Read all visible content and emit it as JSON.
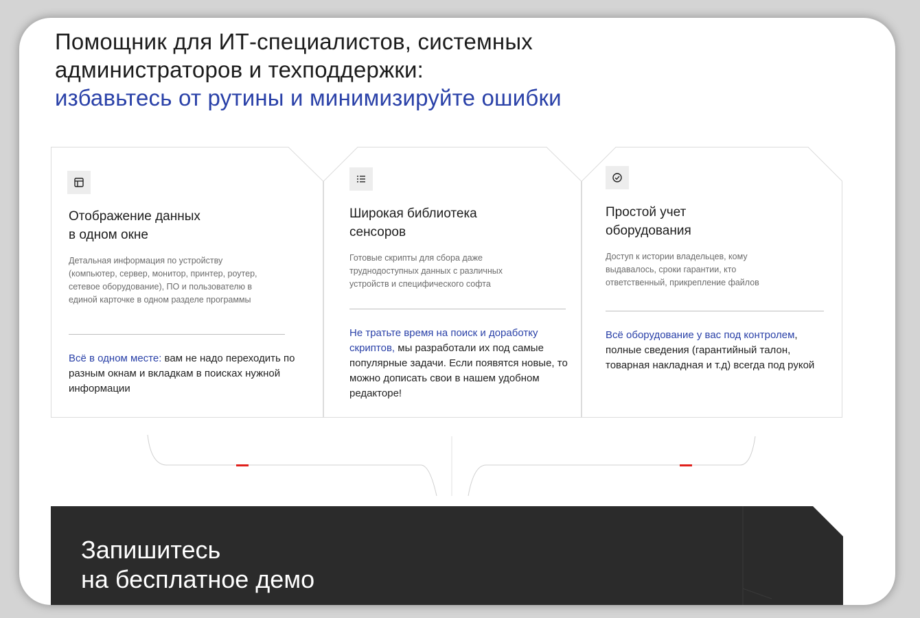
{
  "header": {
    "line1": "Помощник для ИТ-специалистов, системных",
    "line2": "администраторов и техподдержки:",
    "accent": "избавьтесь от рутины и минимизируйте ошибки"
  },
  "cards": [
    {
      "icon": "layout-icon",
      "title": "Отображение данных\nв одном окне",
      "description": "Детальная информация по устройству (компьютер, сервер, монитор, принтер, роутер, сетевое оборудование), ПО и пользователю в единой карточке в одном разделе программы",
      "highlight": "Всё в одном месте:",
      "text": " вам не надо переходить по разным окнам и вкладкам в поисках нужной информации"
    },
    {
      "icon": "list-icon",
      "title": "Широкая библиотека\nсенсоров",
      "description": "Готовые скрипты для сбора даже труднодоступных данных с различных устройств и специфического софта",
      "highlight": "Не тратьте время на поиск и доработку скриптов,",
      "text": " мы разработали их под самые популярные задачи. Если появятся новые, то можно дописать свои в нашем удобном редакторе!"
    },
    {
      "icon": "check-circle-icon",
      "title": "Простой учет\nоборудования",
      "description": "Доступ к истории владельцев, кому выдавалось, сроки гарантии, кто ответственный, прикрепление файлов",
      "highlight": "Всё оборудование у вас под контролем",
      "text": ", полные сведения (гарантийный талон, товарная накладная и т.д) всегда под рукой"
    }
  ],
  "cta": {
    "line1": "Запишитесь",
    "line2": "на бесплатное демо"
  },
  "colors": {
    "accent": "#2a41a8",
    "marker": "#e0201b",
    "cta_bg": "#2b2b2b"
  }
}
